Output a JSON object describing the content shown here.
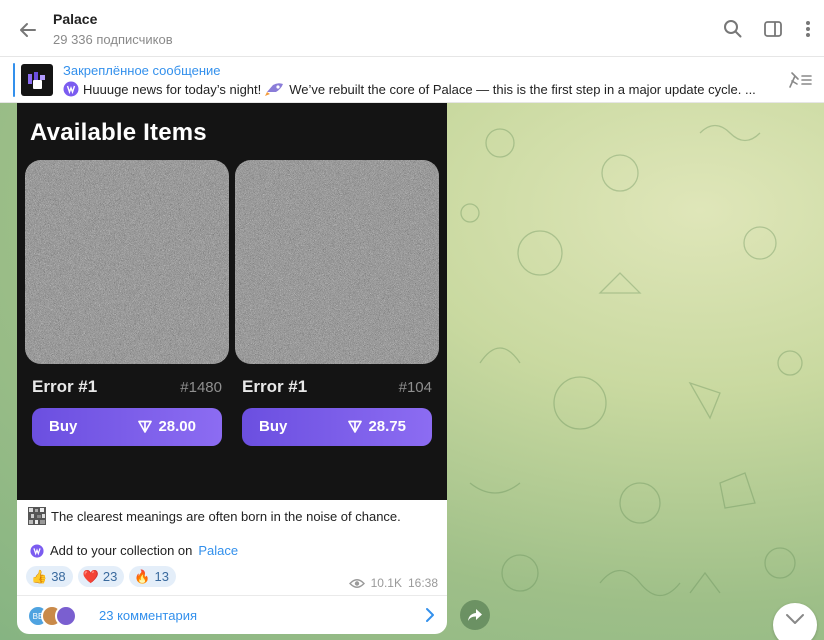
{
  "header": {
    "title": "Palace",
    "subscribers": "29 336 подписчиков",
    "icons": [
      "back-arrow-icon",
      "search-icon",
      "sidebar-toggle-icon",
      "more-vertical-icon"
    ]
  },
  "pinned": {
    "label": "Закреплённое сообщение",
    "text_part1": "Huuuge news for today’s night!",
    "text_part2": "We’ve rebuilt the core of Palace — this is the first step in a major update cycle. ...",
    "accent": "#3390ec"
  },
  "post": {
    "media_title": "Available Items",
    "items": [
      {
        "name": "Error #1",
        "number": "#1480",
        "buy_label": "Buy",
        "price": "28.00"
      },
      {
        "name": "Error #1",
        "number": "#104",
        "buy_label": "Buy",
        "price": "28.75"
      }
    ],
    "caption": "The clearest meanings are often born in the noise of chance.",
    "cta_prefix": "Add to your collection on",
    "cta_link": "Palace",
    "reactions": [
      {
        "emoji": "👍",
        "count": "38"
      },
      {
        "emoji": "❤️",
        "count": "23"
      },
      {
        "emoji": "🔥",
        "count": "13"
      }
    ],
    "views": "10.1K",
    "time": "16:38",
    "comments": "23 комментария",
    "commenter_avatar_initials": "BB"
  },
  "colors": {
    "button_gradient_start": "#6b4fe0",
    "button_gradient_end": "#8c6cf2",
    "link": "#3390ec",
    "reaction_bg": "#e4eef9"
  }
}
